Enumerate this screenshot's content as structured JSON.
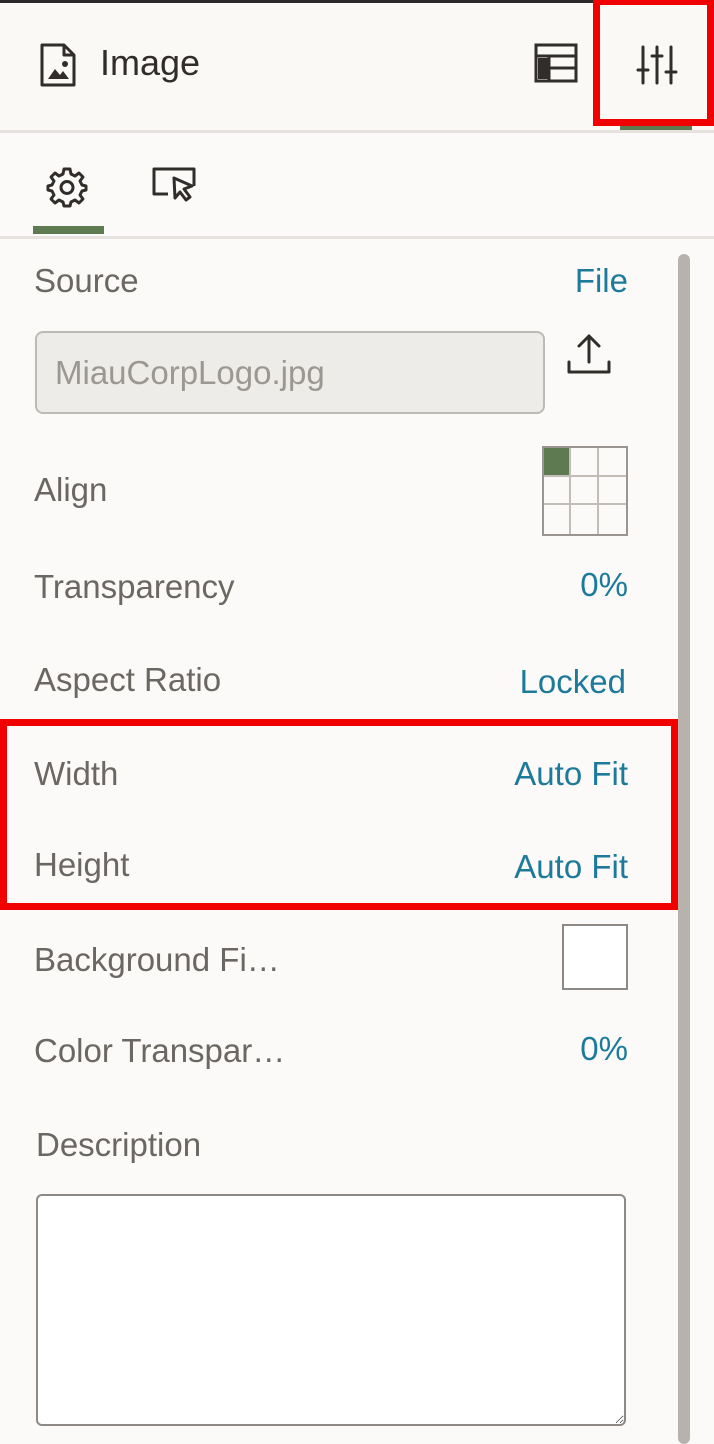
{
  "header": {
    "title": "Image",
    "title_icon": "image-file-icon",
    "layout_icon": "layout-panel-icon",
    "properties_icon": "sliders-icon"
  },
  "tabs": [
    {
      "name": "general",
      "icon": "gear-icon",
      "active": true
    },
    {
      "name": "actions",
      "icon": "cursor-action-icon",
      "active": false
    }
  ],
  "properties": {
    "source": {
      "label": "Source",
      "value": "File"
    },
    "file_name": "MiauCorpLogo.jpg",
    "align": {
      "label": "Align",
      "selected_cell": "top-left"
    },
    "transparency": {
      "label": "Transparency",
      "value": "0%"
    },
    "aspect_ratio": {
      "label": "Aspect Ratio",
      "value": "Locked"
    },
    "width": {
      "label": "Width",
      "value": "Auto Fit"
    },
    "height": {
      "label": "Height",
      "value": "Auto Fit"
    },
    "background_fill": {
      "label": "Background Fi…",
      "color": "#ffffff"
    },
    "color_transparency": {
      "label": "Color Transpar…",
      "value": "0%"
    },
    "description": {
      "label": "Description",
      "value": ""
    }
  },
  "colors": {
    "accent_green": "#5d7a50",
    "link_blue": "#1d7a9b",
    "highlight_red": "#f00000"
  }
}
